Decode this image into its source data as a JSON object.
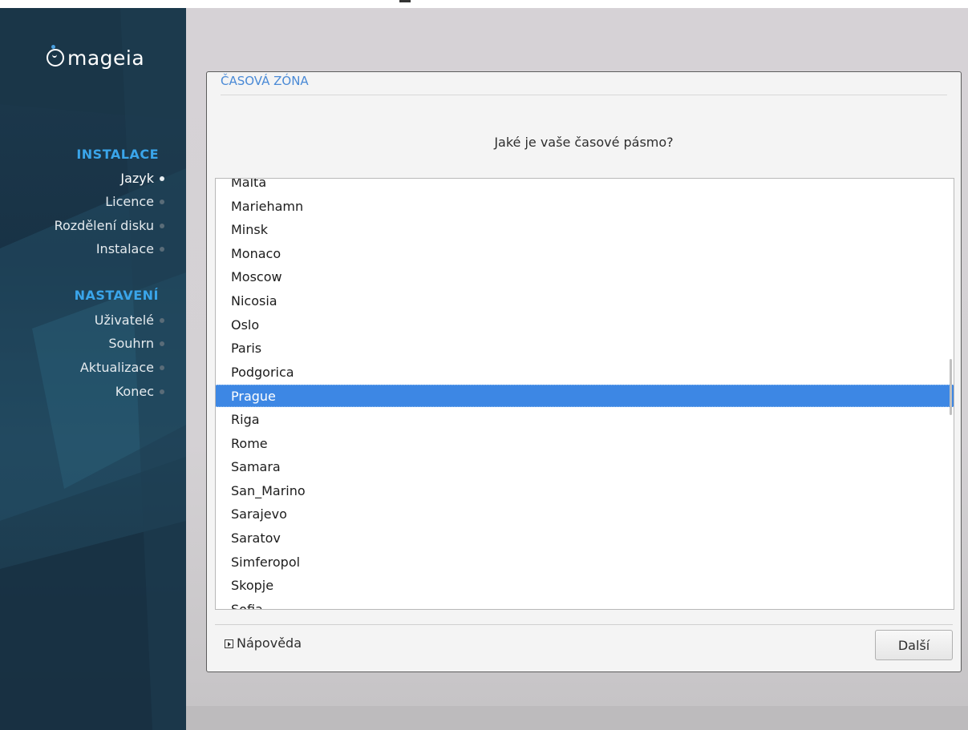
{
  "app": {
    "logo_text": "mageia"
  },
  "sidebar": {
    "sections": [
      {
        "title": "INSTALACE",
        "steps": [
          "Jazyk",
          "Licence",
          "Rozdělení disku",
          "Instalace"
        ]
      },
      {
        "title": "NASTAVENÍ",
        "steps": [
          "Uživatelé",
          "Souhrn",
          "Aktualizace",
          "Konec"
        ]
      }
    ],
    "active_step": "Jazyk"
  },
  "dialog": {
    "title": "ČASOVÁ ZÓNA",
    "question": "Jaké je vaše časové pásmo?",
    "timezones": [
      "Malta",
      "Mariehamn",
      "Minsk",
      "Monaco",
      "Moscow",
      "Nicosia",
      "Oslo",
      "Paris",
      "Podgorica",
      "Prague",
      "Riga",
      "Rome",
      "Samara",
      "San_Marino",
      "Sarajevo",
      "Saratov",
      "Simferopol",
      "Skopje",
      "Sofia"
    ],
    "selected": "Prague",
    "help_label": "Nápověda",
    "next_label": "Další"
  },
  "colors": {
    "accent": "#3aa5ea",
    "selection": "#3d87e4",
    "title": "#4a8ad6"
  }
}
